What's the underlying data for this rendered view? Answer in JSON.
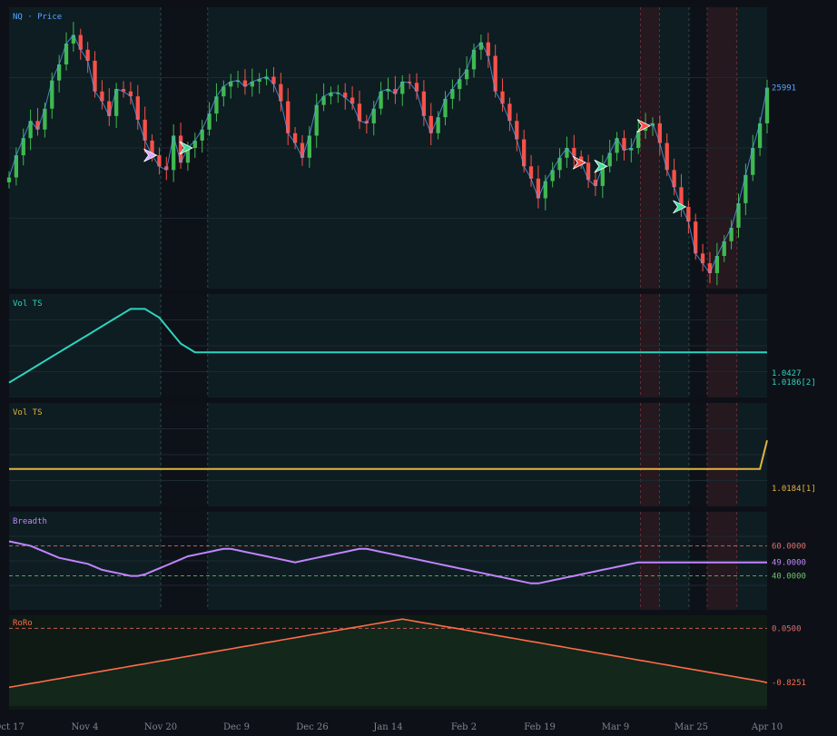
{
  "x_ticks": [
    "Oct 17",
    "Nov 4",
    "Nov 20",
    "Dec 9",
    "Dec 26",
    "Jan 14",
    "Feb 2",
    "Feb 19",
    "Mar 9",
    "Mar 25",
    "Apr 10"
  ],
  "colors": {
    "background": "#0d1117",
    "panel_bg": "#0e1d22",
    "shade_dark": "#0d1218",
    "shade_red": "#25181f",
    "up": "#3fb950",
    "down": "#f85149",
    "price_line": "#58a6ff",
    "vol1": "#2dd4bf",
    "vol2": "#e3b341",
    "breadth": "#c084fc",
    "robo": "#ff6b4a",
    "raw": "#6e7681",
    "grid": "#1c2a30"
  },
  "regimes": [
    {
      "from": 0.2,
      "to": 0.262,
      "kind": "dark"
    },
    {
      "from": 0.833,
      "to": 0.858,
      "kind": "red"
    },
    {
      "from": 0.897,
      "to": 0.921,
      "kind": "dark"
    },
    {
      "from": 0.921,
      "to": 0.96,
      "kind": "red"
    }
  ],
  "chart_data": [
    {
      "type": "candlestick",
      "panel_label": "NQ · Price",
      "last_value_label": "25991",
      "ylim": [
        24400,
        26600
      ],
      "close": [
        25260,
        25440,
        25580,
        25720,
        25650,
        25820,
        26050,
        26180,
        26350,
        26420,
        26300,
        26210,
        25960,
        25880,
        25760,
        25980,
        25960,
        25920,
        25730,
        25560,
        25440,
        25350,
        25320,
        25600,
        25380,
        25500,
        25560,
        25650,
        25780,
        25920,
        26000,
        26040,
        26050,
        26000,
        26040,
        26060,
        26080,
        26020,
        25880,
        25620,
        25540,
        25420,
        25600,
        25850,
        25920,
        25950,
        25950,
        25910,
        25860,
        25720,
        25700,
        25820,
        25960,
        25980,
        25940,
        26040,
        26030,
        25960,
        25760,
        25620,
        25750,
        25900,
        25980,
        26060,
        26140,
        26300,
        26360,
        26250,
        25960,
        25860,
        25720,
        25570,
        25350,
        25250,
        25090,
        25230,
        25320,
        25420,
        25500,
        25430,
        25380,
        25240,
        25190,
        25350,
        25460,
        25580,
        25480,
        25500,
        25640,
        25680,
        25700,
        25540,
        25320,
        25180,
        25020,
        24900,
        24640,
        24560,
        24480,
        24620,
        24740,
        24850,
        25050,
        25280,
        25500,
        25700,
        25991
      ],
      "x_ticks": [
        "Oct 17",
        "Nov 4",
        "Nov 20",
        "Dec 9",
        "Dec 26",
        "Jan 14",
        "Feb 2",
        "Feb 19",
        "Mar 9",
        "Mar 25",
        "Apr 10"
      ],
      "signals": [
        {
          "bar": 20,
          "kind": "neutral"
        },
        {
          "bar": 25,
          "kind": "buy"
        },
        {
          "bar": 80,
          "kind": "sell"
        },
        {
          "bar": 83,
          "kind": "buy"
        },
        {
          "bar": 89,
          "kind": "sell"
        },
        {
          "bar": 94,
          "kind": "buy"
        }
      ]
    },
    {
      "type": "line",
      "panel_label": "Vol TS",
      "series": [
        {
          "values": [
            0.95,
            0.96,
            0.97,
            0.98,
            0.99,
            1.0,
            1.01,
            1.02,
            1.03,
            1.04,
            1.05,
            1.06,
            1.07,
            1.08,
            1.09,
            1.1,
            1.11,
            1.12,
            1.12,
            1.12,
            1.11,
            1.1,
            1.08,
            1.06,
            1.04,
            1.03,
            1.02,
            1.02,
            1.02,
            1.02,
            1.02,
            1.02,
            1.02,
            1.02,
            1.02,
            1.02,
            1.02,
            1.02,
            1.02,
            1.02,
            1.02,
            1.02,
            1.02,
            1.02,
            1.02,
            1.02,
            1.02,
            1.02,
            1.02,
            1.02,
            1.02,
            1.02,
            1.02,
            1.02,
            1.02,
            1.02,
            1.02,
            1.02,
            1.02,
            1.02,
            1.02,
            1.02,
            1.02,
            1.02,
            1.02,
            1.02,
            1.02,
            1.02,
            1.02,
            1.02,
            1.02,
            1.02,
            1.02,
            1.02,
            1.02,
            1.02,
            1.02,
            1.02,
            1.02,
            1.02,
            1.02,
            1.02,
            1.02,
            1.02,
            1.02,
            1.02,
            1.02,
            1.02,
            1.02,
            1.02,
            1.02,
            1.02,
            1.02,
            1.02,
            1.02,
            1.02,
            1.02,
            1.02,
            1.02,
            1.02,
            1.02,
            1.02,
            1.02,
            1.02,
            1.02,
            1.02,
            1.02
          ]
        }
      ],
      "value_labels": [
        "1.0427",
        "1.0186[2]"
      ]
    },
    {
      "type": "line",
      "panel_label": "Vol TS",
      "series": [
        {
          "values": [
            1.0,
            1.0,
            1.0,
            1.0,
            1.0,
            1.0,
            1.0,
            1.0,
            1.0,
            1.0,
            1.0,
            1.0,
            1.0,
            1.0,
            1.0,
            1.0,
            1.0,
            1.0,
            1.0,
            1.0,
            1.0,
            1.0,
            1.0,
            1.0,
            1.0,
            1.0,
            1.0,
            1.0,
            1.0,
            1.0,
            1.0,
            1.0,
            1.0,
            1.0,
            1.0,
            1.0,
            1.0,
            1.0,
            1.0,
            1.0,
            1.0,
            1.0,
            1.0,
            1.0,
            1.0,
            1.0,
            1.0,
            1.0,
            1.0,
            1.0,
            1.0,
            1.0,
            1.0,
            1.0,
            1.0,
            1.0,
            1.0,
            1.0,
            1.0,
            1.0,
            1.0,
            1.0,
            1.0,
            1.0,
            1.0,
            1.0,
            1.0,
            1.0,
            1.0,
            1.0,
            1.0,
            1.0,
            1.0,
            1.0,
            1.0,
            1.0,
            1.0,
            1.0,
            1.0,
            1.0,
            1.0,
            1.0,
            1.0,
            1.0,
            1.0,
            1.0,
            1.0,
            1.0,
            1.0,
            1.0,
            1.0,
            1.0,
            1.0,
            1.0,
            1.0,
            1.0,
            1.0,
            1.0,
            1.0,
            1.0,
            1.0,
            1.0,
            1.0,
            1.0,
            1.0,
            1.0,
            1.0184
          ]
        }
      ],
      "value_labels": [
        "1.0184[1]"
      ]
    },
    {
      "type": "line",
      "panel_label": "Breadth",
      "ylim": [
        20,
        80
      ],
      "series": [
        {
          "values": [
            63,
            62,
            61,
            60,
            58,
            56,
            54,
            52,
            51,
            50,
            49,
            48,
            46,
            44,
            43,
            42,
            41,
            40,
            40,
            41,
            43,
            45,
            47,
            49,
            51,
            53,
            54,
            55,
            56,
            57,
            58,
            58,
            57,
            56,
            55,
            54,
            53,
            52,
            51,
            50,
            49,
            50,
            51,
            52,
            53,
            54,
            55,
            56,
            57,
            58,
            58,
            57,
            56,
            55,
            54,
            53,
            52,
            51,
            50,
            49,
            48,
            47,
            46,
            45,
            44,
            43,
            42,
            41,
            40,
            39,
            38,
            37,
            36,
            35,
            35,
            36,
            37,
            38,
            39,
            40,
            41,
            42,
            43,
            44,
            45,
            46,
            47,
            48,
            49,
            49,
            49,
            49,
            49,
            49,
            49,
            49,
            49,
            49,
            49,
            49,
            49,
            49,
            49,
            49,
            49,
            49,
            49
          ]
        }
      ],
      "levels": [
        60,
        40
      ],
      "value_labels": [
        "60.0000",
        "49.0000",
        "40.0000"
      ]
    },
    {
      "type": "area",
      "panel_label": "RoRo",
      "ylim": [
        -1.2,
        0.2
      ],
      "series": [
        {
          "values": [
            -0.9,
            -0.88,
            -0.86,
            -0.84,
            -0.82,
            -0.8,
            -0.78,
            -0.76,
            -0.74,
            -0.72,
            -0.7,
            -0.68,
            -0.66,
            -0.64,
            -0.62,
            -0.6,
            -0.58,
            -0.56,
            -0.54,
            -0.52,
            -0.5,
            -0.48,
            -0.46,
            -0.44,
            -0.42,
            -0.4,
            -0.38,
            -0.36,
            -0.34,
            -0.32,
            -0.3,
            -0.28,
            -0.26,
            -0.24,
            -0.22,
            -0.2,
            -0.18,
            -0.16,
            -0.14,
            -0.12,
            -0.1,
            -0.08,
            -0.06,
            -0.04,
            -0.02,
            0.0,
            0.02,
            0.04,
            0.06,
            0.08,
            0.1,
            0.12,
            0.14,
            0.16,
            0.18,
            0.2,
            0.18,
            0.16,
            0.14,
            0.12,
            0.1,
            0.08,
            0.06,
            0.04,
            0.02,
            0.0,
            -0.02,
            -0.04,
            -0.06,
            -0.08,
            -0.1,
            -0.12,
            -0.14,
            -0.16,
            -0.18,
            -0.2,
            -0.22,
            -0.24,
            -0.26,
            -0.28,
            -0.3,
            -0.32,
            -0.34,
            -0.36,
            -0.38,
            -0.4,
            -0.42,
            -0.44,
            -0.46,
            -0.48,
            -0.5,
            -0.52,
            -0.54,
            -0.56,
            -0.58,
            -0.6,
            -0.62,
            -0.64,
            -0.66,
            -0.68,
            -0.7,
            -0.72,
            -0.74,
            -0.76,
            -0.78,
            -0.8,
            -0.8251
          ]
        }
      ],
      "levels": [
        0.05
      ],
      "value_labels": [
        "0.0500",
        "-0.8251"
      ]
    }
  ]
}
